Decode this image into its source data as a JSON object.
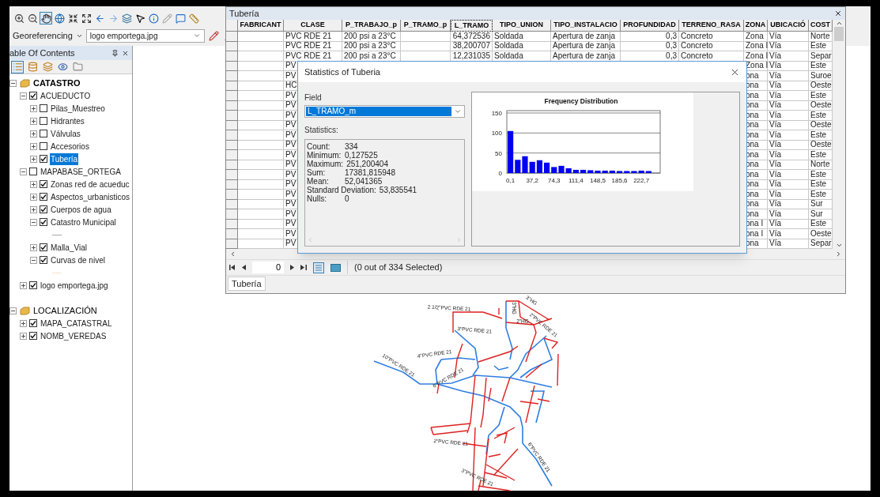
{
  "toolbar": {
    "georeferencing_label": "Georeferencing",
    "layer_select": {
      "value": "logo emportega.jpg"
    }
  },
  "toc": {
    "title": "able Of Contents",
    "tree": [
      {
        "kind": "group",
        "label": "CATASTRO",
        "active": true,
        "expanded": true,
        "children": [
          {
            "kind": "layer",
            "label": "ACUEDUCTO",
            "checked": true,
            "expanded": true,
            "selected": false,
            "children": [
              {
                "kind": "layer",
                "label": "Pilas_Muestreo",
                "checked": false,
                "expanded": false,
                "selected": false
              },
              {
                "kind": "layer",
                "label": "Hidrantes",
                "checked": false,
                "expanded": false,
                "selected": false
              },
              {
                "kind": "layer",
                "label": "Válvulas",
                "checked": false,
                "expanded": false,
                "selected": false
              },
              {
                "kind": "layer",
                "label": "Accesorios",
                "checked": false,
                "expanded": false,
                "selected": false
              },
              {
                "kind": "layer",
                "label": "Tubería",
                "checked": true,
                "expanded": false,
                "selected": true
              }
            ]
          },
          {
            "kind": "layer",
            "label": "MAPABASE_ORTEGA",
            "checked": false,
            "expanded": true,
            "selected": false,
            "children": [
              {
                "kind": "layer",
                "label": "Zonas red de acueduc",
                "checked": true,
                "expanded": false,
                "selected": false
              },
              {
                "kind": "layer",
                "label": "Aspectos_urbanisticos",
                "checked": true,
                "expanded": false,
                "selected": false
              },
              {
                "kind": "layer",
                "label": "Cuerpos de agua",
                "checked": true,
                "expanded": false,
                "selected": false
              },
              {
                "kind": "layer",
                "label": "Catastro Municipal",
                "checked": true,
                "expanded": true,
                "selected": false,
                "color": "#a6a6a6"
              },
              {
                "kind": "layer",
                "label": "Malla_Vial",
                "checked": true,
                "expanded": false,
                "selected": false
              },
              {
                "kind": "layer",
                "label": "Curvas de nivel",
                "checked": true,
                "expanded": true,
                "selected": false,
                "color": "#f3e6c8"
              }
            ]
          },
          {
            "kind": "layer",
            "label": "logo emportega.jpg",
            "checked": true,
            "expanded": false,
            "selected": false
          }
        ]
      },
      {
        "kind": "group",
        "label": "LOCALIZACIÓN",
        "active": false,
        "expanded": true,
        "children": [
          {
            "kind": "layer",
            "label": "MAPA_CATASTRAL",
            "checked": true,
            "expanded": false,
            "selected": false
          },
          {
            "kind": "layer",
            "label": "NOMB_VEREDAS",
            "checked": true,
            "expanded": false,
            "selected": false
          }
        ]
      }
    ]
  },
  "table_window": {
    "title": "Tubería",
    "columns": [
      {
        "label": "FABRICANT",
        "selected": false
      },
      {
        "label": "CLASE",
        "selected": false
      },
      {
        "label": "P_TRABAJO_p",
        "selected": false
      },
      {
        "label": "P_TRAMO_p",
        "selected": false
      },
      {
        "label": "L_TRAMO",
        "selected": true
      },
      {
        "label": "TIPO_UNION",
        "selected": false
      },
      {
        "label": "TIPO_INSTALACIO",
        "selected": false
      },
      {
        "label": "PROFUNDIDAD",
        "selected": false
      },
      {
        "label": "TERRENO_RASA",
        "selected": false
      },
      {
        "label": "ZONA",
        "selected": false
      },
      {
        "label": "UBICACIÓ",
        "selected": false
      },
      {
        "label": "COST",
        "selected": false
      }
    ],
    "rows": [
      [
        null,
        "PVC RDE 21",
        "200 psi a 23°C",
        null,
        "64,372536",
        "Soldada",
        "Apertura de zanja",
        "0,3",
        "Concreto",
        "Zona",
        "Vía",
        "Norte"
      ],
      [
        null,
        "PVC RDE 21",
        "200 psi a 23°C",
        null,
        "38,200707",
        "Soldada",
        "Apertura de zanja",
        "0,3",
        "Concreto",
        "Zona I",
        "Vía",
        "Este"
      ],
      [
        null,
        "PVC RDE 21",
        "200 psi a 23°C",
        null,
        "12,231035",
        "Soldada",
        "Apertura de zanja",
        "0,3",
        "Concreto",
        "Zona I",
        "Vía",
        "Separ"
      ],
      [
        null,
        "PV",
        null,
        null,
        null,
        null,
        null,
        null,
        null,
        "Zona I",
        "Vía",
        "Este"
      ],
      [
        null,
        "PV",
        null,
        null,
        null,
        null,
        null,
        null,
        null,
        "ona",
        "Vía",
        "Suroe"
      ],
      [
        null,
        "HC",
        null,
        null,
        null,
        null,
        null,
        null,
        null,
        "ona",
        "Vía",
        "Oeste"
      ],
      [
        null,
        "PV",
        null,
        null,
        null,
        null,
        null,
        null,
        null,
        "ona",
        "Vía",
        "Este"
      ],
      [
        null,
        "PV",
        null,
        null,
        null,
        null,
        null,
        null,
        null,
        "ona",
        "Vía",
        "Oeste"
      ],
      [
        null,
        "PV",
        null,
        null,
        null,
        null,
        null,
        null,
        null,
        "ona",
        "Vía",
        "Este"
      ],
      [
        null,
        "PV",
        null,
        null,
        null,
        null,
        null,
        null,
        null,
        "ona",
        "Vía",
        "Oeste"
      ],
      [
        null,
        "PV",
        null,
        null,
        null,
        null,
        null,
        null,
        null,
        "ona",
        "Vía",
        "Este"
      ],
      [
        null,
        "PV",
        null,
        null,
        null,
        null,
        null,
        null,
        null,
        "ona",
        "Vía",
        "Oeste"
      ],
      [
        null,
        "PV",
        null,
        null,
        null,
        null,
        null,
        null,
        null,
        "ona",
        "Vía",
        "Este"
      ],
      [
        null,
        "PV",
        null,
        null,
        null,
        null,
        null,
        null,
        null,
        "ona",
        "Vía",
        "Norte"
      ],
      [
        null,
        "PV",
        null,
        null,
        null,
        null,
        null,
        null,
        null,
        "ona",
        "Vía",
        "Este"
      ],
      [
        null,
        "PV",
        null,
        null,
        null,
        null,
        null,
        null,
        null,
        "ona",
        "Vía",
        "Este"
      ],
      [
        null,
        "PV",
        null,
        null,
        null,
        null,
        null,
        null,
        null,
        "ona",
        "Vía",
        "Este"
      ],
      [
        null,
        "PV",
        null,
        null,
        null,
        null,
        null,
        null,
        null,
        "ona",
        "Vía",
        "Sur"
      ],
      [
        null,
        "PV",
        null,
        null,
        null,
        null,
        null,
        null,
        null,
        "ona",
        "Vía",
        "Sur"
      ],
      [
        null,
        "PV",
        null,
        null,
        null,
        null,
        null,
        null,
        null,
        "ona I",
        "Vía",
        "Este"
      ],
      [
        null,
        "PV",
        null,
        null,
        null,
        null,
        null,
        null,
        null,
        "ona I",
        "Vía",
        "Oeste"
      ],
      [
        null,
        "PV",
        null,
        null,
        null,
        null,
        null,
        null,
        null,
        "ona",
        "Vía",
        "Separ"
      ]
    ],
    "record_field": "0",
    "selection_status": "(0 out of 334 Selected)",
    "tabs": [
      {
        "label": "Tubería",
        "selected": true
      }
    ]
  },
  "statistics_dialog": {
    "title": "Statistics of Tuberia",
    "field_label": "Field",
    "field_value": "L_TRAMO_m",
    "statistics_label": "Statistics:",
    "statistics": [
      {
        "label": "Count:",
        "value": "334"
      },
      {
        "label": "Minimum:",
        "value": "0,127525"
      },
      {
        "label": "Maximum:",
        "value": "251,200404"
      },
      {
        "label": "Sum:",
        "value": "17381,815948"
      },
      {
        "label": "Mean:",
        "value": "52,041365"
      },
      {
        "label": "Standard Deviation:",
        "value": "53,835541"
      },
      {
        "label": "Nulls:",
        "value": "0"
      }
    ],
    "chart_data": {
      "type": "bar",
      "title": "Frequency Distribution",
      "ylim": [
        0,
        150
      ],
      "yticks": [
        0,
        50,
        100,
        150
      ],
      "x": [
        0.1,
        12.5,
        24.8,
        37.2,
        49.6,
        61.9,
        74.3,
        86.7,
        99.0,
        111.4,
        123.8,
        136.1,
        148.5,
        160.9,
        173.2,
        185.6,
        198.0,
        210.3,
        222.7,
        235.1
      ],
      "xlim": [
        -6.1,
        241.3
      ],
      "xticks": [
        {
          "value": 0.1,
          "label": "0,1"
        },
        {
          "value": 37.2,
          "label": "37,2"
        },
        {
          "value": 74.3,
          "label": "74,3"
        },
        {
          "value": 111.4,
          "label": "111,4"
        },
        {
          "value": 148.5,
          "label": "148,5"
        },
        {
          "value": 185.6,
          "label": "185,6"
        },
        {
          "value": 222.7,
          "label": "222,7"
        }
      ],
      "series": [
        {
          "color": "#0000f0",
          "values": [
            105,
            33,
            42,
            28,
            32,
            26,
            15,
            18,
            12,
            8,
            8,
            7,
            6,
            6,
            6,
            5,
            5,
            5,
            6,
            5
          ]
        }
      ]
    }
  },
  "map": {
    "labels": [
      "2 1/2\"PVC RDE 21",
      "3\"HG",
      "3\"HG",
      "2\"HG",
      "2\"PVC RDE 21",
      "3\"PVC RDE 21",
      "4\"PVC RDE 21",
      "10\"PVC RDE 21",
      "6\"PVC RDE 21",
      "2\"PVC RDE 21",
      "6\"PVC RDE 21",
      "3\"PVC RDE 21"
    ]
  }
}
